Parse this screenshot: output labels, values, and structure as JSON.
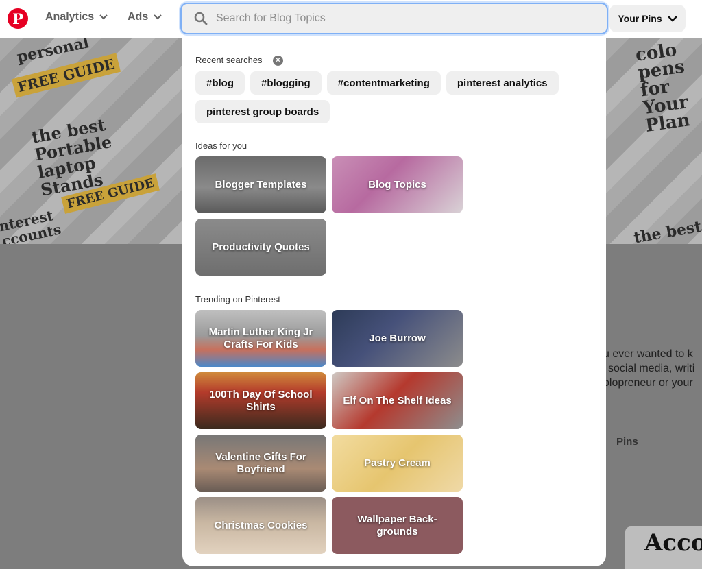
{
  "topbar": {
    "logo_letter": "P",
    "nav": [
      {
        "label": "Analytics"
      },
      {
        "label": "Ads"
      }
    ],
    "search": {
      "placeholder": "Search for Blog Topics",
      "value": ""
    },
    "your_pins": {
      "label": "Your Pins"
    }
  },
  "dropdown": {
    "recent": {
      "label": "Recent searches",
      "chips": [
        "#blog",
        "#blogging",
        "#contentmarketing",
        "pinterest analytics",
        "pinterest group boards"
      ]
    },
    "ideas": {
      "label": "Ideas for you",
      "tiles": [
        "Blogger Templates",
        "Blog Topics",
        "Productivity Quotes"
      ]
    },
    "trending": {
      "label": "Trending on Pinterest",
      "tiles": [
        "Martin Luther King Jr Crafts For Kids",
        "Joe Burrow",
        "100Th Day Of School Shirts",
        "Elf On The Shelf Ideas",
        "Valentine Gifts For Boyfriend",
        "Pastry Cream",
        "Christmas Cookies",
        "Wallpaper Back- grounds"
      ]
    }
  },
  "background": {
    "collage_left": [
      "personal",
      "FREE GUIDE",
      "the best Portable laptop Stands",
      "FREE GUIDE",
      "nterest ccounts"
    ],
    "collage_right": [
      "colo pens for Your Plan",
      "the best"
    ],
    "bio_lines": [
      "u ever wanted to k",
      "social media, writi",
      "olopreneur or your"
    ],
    "tab_pins": "Pins",
    "acc": "Acco"
  }
}
